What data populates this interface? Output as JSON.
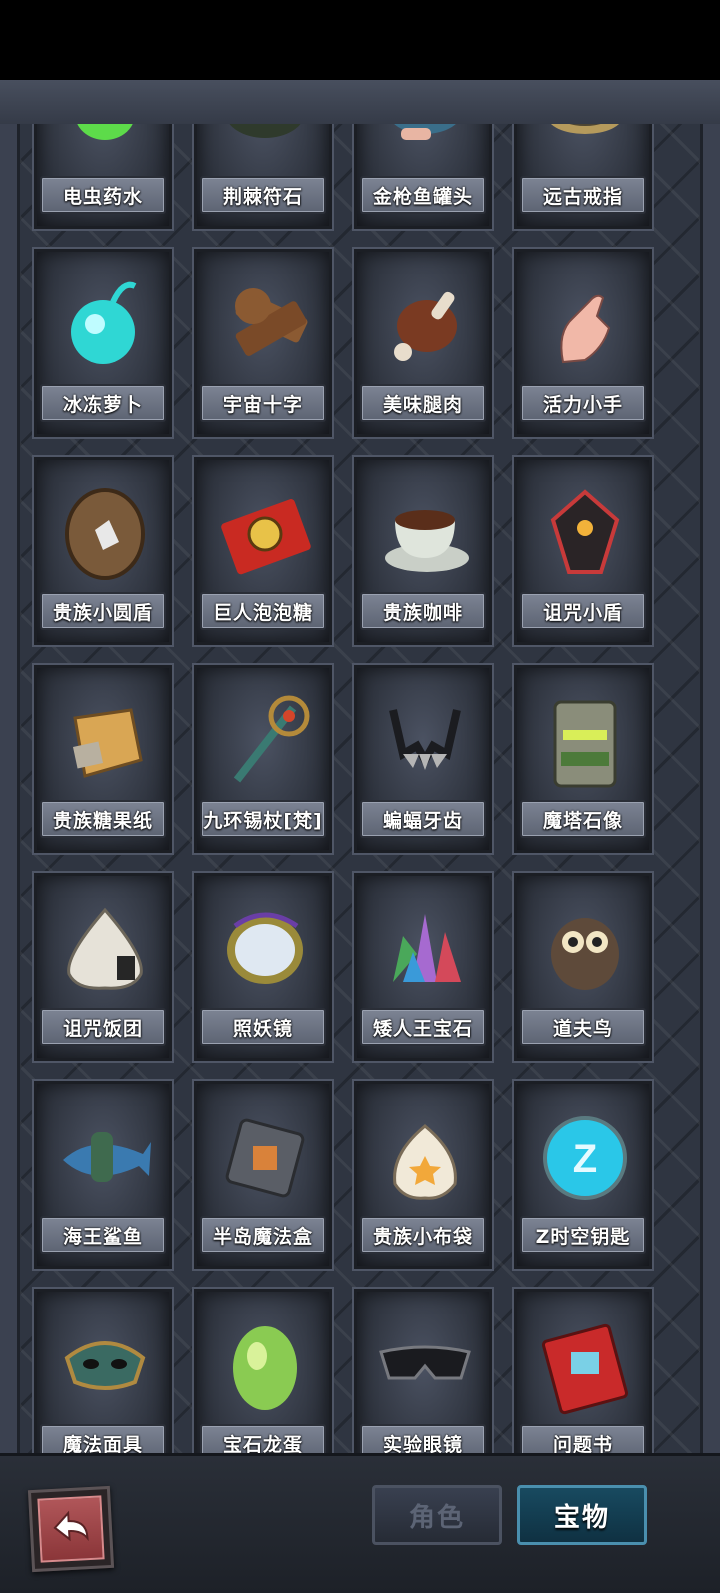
{
  "tabs": {
    "role_label": "角色",
    "treasure_label": "宝物",
    "active": "宝物"
  },
  "items": [
    {
      "name": "电虫药水",
      "icon": "electric-bug-potion-icon"
    },
    {
      "name": "荆棘符石",
      "icon": "thorn-rune-stone-icon"
    },
    {
      "name": "金枪鱼罐头",
      "icon": "tuna-can-icon"
    },
    {
      "name": "远古戒指",
      "icon": "ancient-ring-icon"
    },
    {
      "name": "冰冻萝卜",
      "icon": "frozen-radish-icon"
    },
    {
      "name": "宇宙十字",
      "icon": "cosmic-cross-icon"
    },
    {
      "name": "美味腿肉",
      "icon": "tasty-drumstick-icon"
    },
    {
      "name": "活力小手",
      "icon": "lively-hand-icon"
    },
    {
      "name": "贵族小圆盾",
      "icon": "noble-buckler-icon"
    },
    {
      "name": "巨人泡泡糖",
      "icon": "giant-bubblegum-icon"
    },
    {
      "name": "贵族咖啡",
      "icon": "noble-coffee-icon"
    },
    {
      "name": "诅咒小盾",
      "icon": "cursed-shield-icon"
    },
    {
      "name": "贵族糖果纸",
      "icon": "noble-candy-wrapper-icon"
    },
    {
      "name": "九环锡杖[梵]",
      "icon": "nine-ring-staff-icon"
    },
    {
      "name": "蝙蝠牙齿",
      "icon": "bat-teeth-icon"
    },
    {
      "name": "魔塔石像",
      "icon": "magic-tower-statue-icon"
    },
    {
      "name": "诅咒饭团",
      "icon": "cursed-rice-ball-icon"
    },
    {
      "name": "照妖镜",
      "icon": "demon-mirror-icon"
    },
    {
      "name": "矮人王宝石",
      "icon": "dwarf-king-gem-icon"
    },
    {
      "name": "道夫鸟",
      "icon": "dodo-bird-icon"
    },
    {
      "name": "海王鲨鱼",
      "icon": "sea-king-shark-icon"
    },
    {
      "name": "半岛魔法盒",
      "icon": "peninsula-magic-box-icon"
    },
    {
      "name": "贵族小布袋",
      "icon": "noble-pouch-icon"
    },
    {
      "name": "Z时空钥匙",
      "icon": "z-spacetime-key-icon"
    },
    {
      "name": "魔法面具",
      "icon": "magic-mask-icon"
    },
    {
      "name": "宝石龙蛋",
      "icon": "gem-dragon-egg-icon"
    },
    {
      "name": "实验眼镜",
      "icon": "lab-glasses-icon"
    },
    {
      "name": "问题书",
      "icon": "question-book-icon"
    }
  ],
  "back_icon": "back-arrow-icon"
}
